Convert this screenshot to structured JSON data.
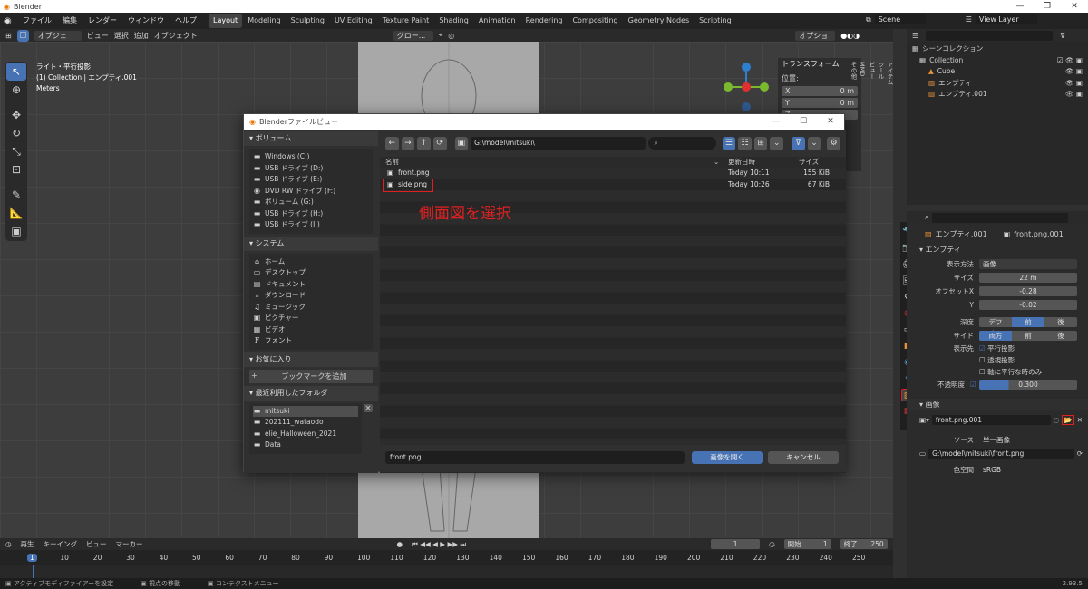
{
  "app": {
    "title": "Blender",
    "version": "2.93.5"
  },
  "menu": {
    "file": "ファイル",
    "edit": "編集",
    "render": "レンダー",
    "window": "ウィンドウ",
    "help": "ヘルプ"
  },
  "workspaces": [
    "Layout",
    "Modeling",
    "Sculpting",
    "UV Editing",
    "Texture Paint",
    "Shading",
    "Animation",
    "Rendering",
    "Compositing",
    "Geometry Nodes",
    "Scripting"
  ],
  "scene": {
    "name": "Scene",
    "view_layer": "View Layer"
  },
  "header3d": {
    "mode": "オブジェク...",
    "view": "ビュー",
    "select": "選択",
    "add": "追加",
    "object": "オブジェクト",
    "orientation": "グロー...",
    "options": "オプション"
  },
  "viewport_info": {
    "line1": "ライト・平行投影",
    "line2": "(1) Collection | エンプティ.001",
    "line3": "Meters"
  },
  "npanel": {
    "section": "トランスフォーム",
    "position": "位置:",
    "x_label": "X",
    "x_val": "0 m",
    "y_label": "Y",
    "y_val": "0 m",
    "z_label": "Z",
    "tabs": [
      "アイテム",
      "ツール",
      "ビュー",
      "MMD",
      "その他"
    ]
  },
  "outliner": {
    "root": "シーンコレクション",
    "collection": "Collection",
    "items": [
      {
        "name": "Cube"
      },
      {
        "name": "エンプティ"
      },
      {
        "name": "エンプティ.001"
      }
    ]
  },
  "properties": {
    "object_name": "エンプティ.001",
    "data_name": "front.png.001",
    "empty_section": "エンプティ",
    "display_label": "表示方法",
    "display_val": "画像",
    "size_label": "サイズ",
    "size_val": "22 m",
    "offset_label": "オフセットX",
    "offset_x": "-0.28",
    "y_label": "Y",
    "offset_y": "-0.02",
    "depth_label": "深度",
    "depth_opts": [
      "デフォ...",
      "前",
      "後"
    ],
    "side_label": "サイド",
    "side_opts": [
      "両方",
      "前",
      "後"
    ],
    "show_label": "表示先",
    "cb1": "平行投影",
    "cb2": "透視投影",
    "cb3": "軸に平行な時のみ",
    "opacity_label": "不透明度",
    "opacity_val": "0.300",
    "image_section": "画像",
    "image_name": "front.png.001",
    "source_label": "ソース",
    "source_val": "単一画像",
    "filepath": "G:\\model\\mitsuki\\front.png",
    "colorspace_label": "色空間",
    "colorspace_val": "sRGB"
  },
  "timeline": {
    "playback": "再生",
    "keying": "キーイング",
    "view": "ビュー",
    "marker": "マーカー",
    "current": "1",
    "start_label": "開始",
    "start": "1",
    "end_label": "終了",
    "end": "250",
    "ticks": [
      "1",
      "10",
      "20",
      "30",
      "40",
      "50",
      "60",
      "70",
      "80",
      "90",
      "100",
      "110",
      "120",
      "130",
      "140",
      "150",
      "160",
      "170",
      "180",
      "190",
      "200",
      "210",
      "220",
      "230",
      "240",
      "250"
    ]
  },
  "statusbar": {
    "left": "アクティブモディファイアーを設定",
    "mid": "視点の移動",
    "right": "コンテクストメニュー"
  },
  "filebrowser": {
    "title": "Blenderファイルビュー",
    "volumes_h": "ボリューム",
    "volumes": [
      "Windows (C:)",
      "USB ドライブ (D:)",
      "USB ドライブ (E:)",
      "DVD RW ドライブ (F:)",
      "ボリューム (G:)",
      "USB ドライブ (H:)",
      "USB ドライブ (I:)"
    ],
    "system_h": "システム",
    "system": [
      "ホーム",
      "デスクトップ",
      "ドキュメント",
      "ダウンロード",
      "ミュージック",
      "ピクチャー",
      "ビデオ",
      "フォント"
    ],
    "favorites_h": "お気に入り",
    "add_bookmark": "ブックマークを追加",
    "recent_h": "最近利用したフォルダ",
    "recent": [
      "mitsuki",
      "202111_wataodo",
      "elie_Halloween_2021",
      "Data"
    ],
    "path": "G:\\model\\mitsuki\\",
    "col_name": "名前",
    "col_date": "更新日時",
    "col_size": "サイズ",
    "files": [
      {
        "name": "front.png",
        "date": "Today 10:11",
        "size": "155 KiB"
      },
      {
        "name": "side.png",
        "date": "Today 10:26",
        "size": "67 KiB"
      }
    ],
    "filename": "front.png",
    "open_btn": "画像を開く",
    "cancel_btn": "キャンセル"
  },
  "annotation": "側面図を選択",
  "colors": {
    "accent": "#4772b3",
    "annotation": "#e02020"
  }
}
